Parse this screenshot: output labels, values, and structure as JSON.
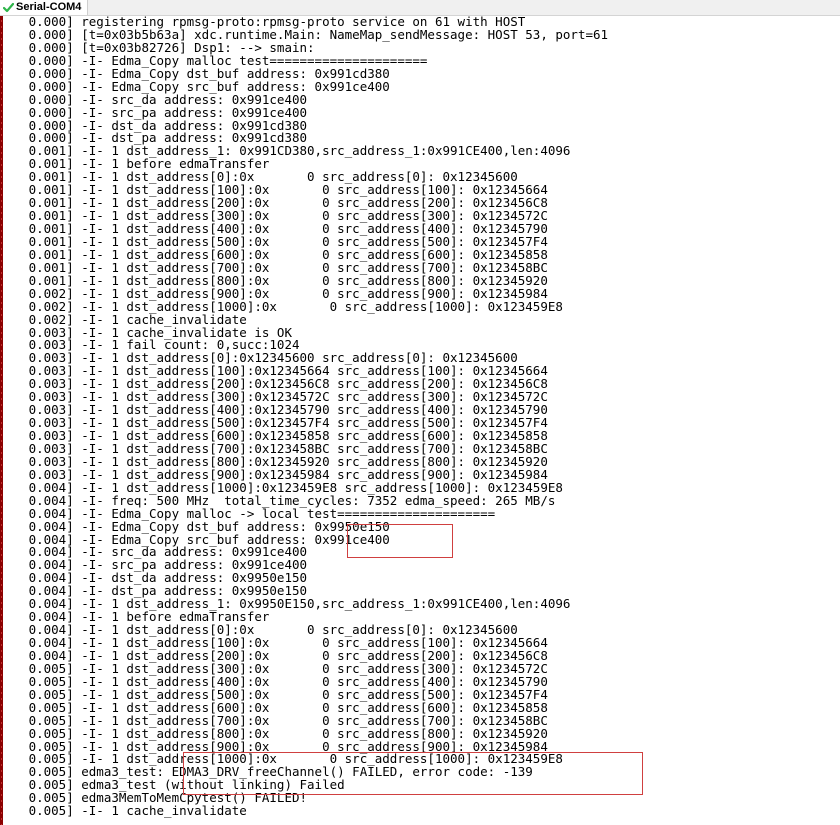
{
  "window": {
    "tab_title": "Serial-COM4",
    "status_color": "#2db54a",
    "highlight_color": "#d04040"
  },
  "terminal": {
    "lines": [
      "   0.000] registering rpmsg-proto:rpmsg-proto service on 61 with HOST",
      "   0.000] [t=0x03b5b63a] xdc.runtime.Main: NameMap_sendMessage: HOST 53, port=61",
      "   0.000] [t=0x03b82726] Dsp1: --> smain:",
      "   0.000] -I- Edma_Copy malloc test=====================",
      "   0.000] -I- Edma_Copy dst_buf address: 0x991cd380",
      "   0.000] -I- Edma_Copy src_buf address: 0x991ce400",
      "   0.000] -I- src_da address: 0x991ce400",
      "   0.000] -I- src_pa address: 0x991ce400",
      "   0.000] -I- dst_da address: 0x991cd380",
      "   0.000] -I- dst_pa address: 0x991cd380",
      "   0.001] -I- 1 dst_address_1: 0x991CD380,src_address_1:0x991CE400,len:4096",
      "   0.001] -I- 1 before edmaTransfer",
      "   0.001] -I- 1 dst_address[0]:0x       0 src_address[0]: 0x12345600",
      "   0.001] -I- 1 dst_address[100]:0x       0 src_address[100]: 0x12345664",
      "   0.001] -I- 1 dst_address[200]:0x       0 src_address[200]: 0x123456C8",
      "   0.001] -I- 1 dst_address[300]:0x       0 src_address[300]: 0x1234572C",
      "   0.001] -I- 1 dst_address[400]:0x       0 src_address[400]: 0x12345790",
      "   0.001] -I- 1 dst_address[500]:0x       0 src_address[500]: 0x123457F4",
      "   0.001] -I- 1 dst_address[600]:0x       0 src_address[600]: 0x12345858",
      "   0.001] -I- 1 dst_address[700]:0x       0 src_address[700]: 0x123458BC",
      "   0.001] -I- 1 dst_address[800]:0x       0 src_address[800]: 0x12345920",
      "   0.002] -I- 1 dst_address[900]:0x       0 src_address[900]: 0x12345984",
      "   0.002] -I- 1 dst_address[1000]:0x       0 src_address[1000]: 0x123459E8",
      "   0.002] -I- 1 cache_invalidate",
      "   0.003] -I- 1 cache_invalidate is OK",
      "   0.003] -I- 1 fail count: 0,succ:1024",
      "   0.003] -I- 1 dst_address[0]:0x12345600 src_address[0]: 0x12345600",
      "   0.003] -I- 1 dst_address[100]:0x12345664 src_address[100]: 0x12345664",
      "   0.003] -I- 1 dst_address[200]:0x123456C8 src_address[200]: 0x123456C8",
      "   0.003] -I- 1 dst_address[300]:0x1234572C src_address[300]: 0x1234572C",
      "   0.003] -I- 1 dst_address[400]:0x12345790 src_address[400]: 0x12345790",
      "   0.003] -I- 1 dst_address[500]:0x123457F4 src_address[500]: 0x123457F4",
      "   0.003] -I- 1 dst_address[600]:0x12345858 src_address[600]: 0x12345858",
      "   0.003] -I- 1 dst_address[700]:0x123458BC src_address[700]: 0x123458BC",
      "   0.003] -I- 1 dst_address[800]:0x12345920 src_address[800]: 0x12345920",
      "   0.003] -I- 1 dst_address[900]:0x12345984 src_address[900]: 0x12345984",
      "   0.004] -I- 1 dst_address[1000]:0x123459E8 src_address[1000]: 0x123459E8",
      "   0.004] -I- freq: 500 MHz  total_time_cycles: 7352 edma_speed: 265 MB/s",
      "   0.004] -I- Edma_Copy malloc -> local test=====================",
      "   0.004] -I- Edma_Copy dst_buf address: 0x9950e150",
      "   0.004] -I- Edma_Copy src_buf address: 0x991ce400",
      "   0.004] -I- src_da address: 0x991ce400",
      "   0.004] -I- src_pa address: 0x991ce400",
      "   0.004] -I- dst_da address: 0x9950e150",
      "   0.004] -I- dst_pa address: 0x9950e150",
      "   0.004] -I- 1 dst_address_1: 0x9950E150,src_address_1:0x991CE400,len:4096",
      "   0.004] -I- 1 before edmaTransfer",
      "   0.004] -I- 1 dst_address[0]:0x       0 src_address[0]: 0x12345600",
      "   0.004] -I- 1 dst_address[100]:0x       0 src_address[100]: 0x12345664",
      "   0.004] -I- 1 dst_address[200]:0x       0 src_address[200]: 0x123456C8",
      "   0.005] -I- 1 dst_address[300]:0x       0 src_address[300]: 0x1234572C",
      "   0.005] -I- 1 dst_address[400]:0x       0 src_address[400]: 0x12345790",
      "   0.005] -I- 1 dst_address[500]:0x       0 src_address[500]: 0x123457F4",
      "   0.005] -I- 1 dst_address[600]:0x       0 src_address[600]: 0x12345858",
      "   0.005] -I- 1 dst_address[700]:0x       0 src_address[700]: 0x123458BC",
      "   0.005] -I- 1 dst_address[800]:0x       0 src_address[800]: 0x12345920",
      "   0.005] -I- 1 dst_address[900]:0x       0 src_address[900]: 0x12345984",
      "   0.005] -I- 1 dst_address[1000]:0x       0 src_address[1000]: 0x123459E8",
      "   0.005] edma3_test: EDMA3_DRV_freeChannel() FAILED, error code: -139",
      "   0.005] edma3_test (without linking) Failed",
      "   0.005] edma3MemToMemCpytest() FAILED!",
      "   0.005] -I- 1 cache_invalidate"
    ]
  }
}
